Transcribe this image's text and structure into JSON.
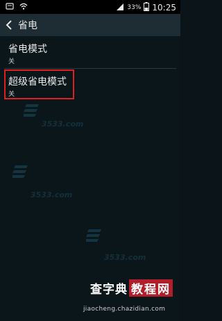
{
  "status_bar": {
    "battery_percent": "33%",
    "time": "10:25"
  },
  "action_bar": {
    "title": "省电"
  },
  "settings": [
    {
      "title": "省电模式",
      "value": "关"
    },
    {
      "title": "超级省电模式",
      "value": "关"
    }
  ],
  "watermarks": {
    "brand_text": "3533.com",
    "site_logo_a": "查字典",
    "site_logo_b": "教程网",
    "site_url": "jiaocheng.chazidian.com"
  },
  "colors": {
    "highlight": "#e02020",
    "action_bar": "#1d2d33",
    "background": "#0b161b"
  }
}
